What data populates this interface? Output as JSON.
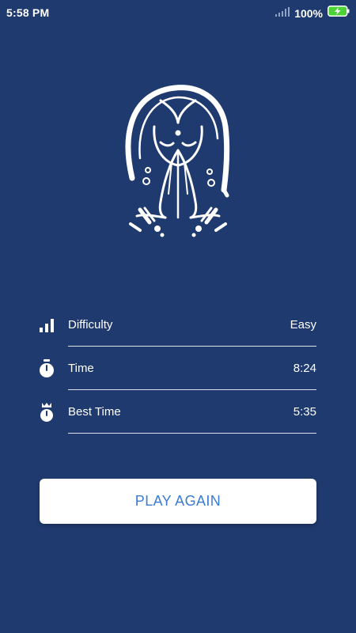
{
  "status_bar": {
    "time": "5:58 PM",
    "battery_percent": "100%",
    "signal_icon": "signal-icon",
    "battery_icon": "battery-charging-icon"
  },
  "illustration": {
    "icon": "namaste-woman-icon"
  },
  "stats": [
    {
      "icon": "difficulty-bars-icon",
      "label": "Difficulty",
      "value": "Easy"
    },
    {
      "icon": "stopwatch-icon",
      "label": "Time",
      "value": "8:24"
    },
    {
      "icon": "crown-stopwatch-icon",
      "label": "Best Time",
      "value": "5:35"
    }
  ],
  "actions": {
    "play_again_label": "PLAY AGAIN"
  },
  "colors": {
    "background": "#1f3a6e",
    "button_text": "#3a7bd5",
    "battery_fill": "#4cd137"
  }
}
